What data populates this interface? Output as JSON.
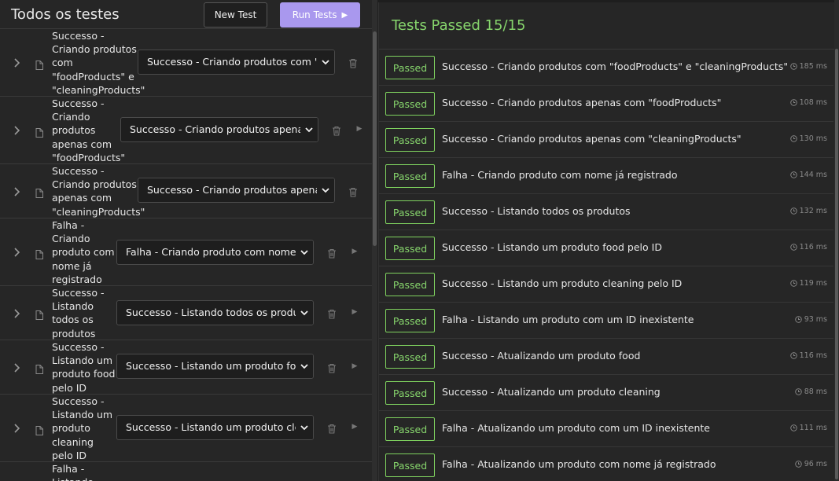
{
  "left": {
    "title": "Todos os testes",
    "new_test_label": "New Test",
    "run_tests_label": "Run Tests",
    "rows": [
      {
        "name": "Successo - Criando produtos com \"foodProducts\" e \"cleaningProducts\"",
        "select_value": "Successo - Criando produtos com \"foodProducts\" e \"cleaningProducts\""
      },
      {
        "name": "Successo - Criando produtos apenas com \"foodProducts\"",
        "select_value": "Successo - Criando produtos apenas com \"foodProducts\""
      },
      {
        "name": "Successo - Criando produtos apenas com \"cleaningProducts\"",
        "select_value": "Successo - Criando produtos apenas com \"cleaningProducts\""
      },
      {
        "name": "Falha - Criando produto com nome já registrado",
        "select_value": "Falha - Criando produto com nome já registrado"
      },
      {
        "name": "Successo - Listando todos os produtos",
        "select_value": "Successo - Listando todos os produtos"
      },
      {
        "name": "Successo - Listando um produto food pelo ID",
        "select_value": "Successo - Listando um produto food pelo ID"
      },
      {
        "name": "Successo - Listando um produto cleaning pelo ID",
        "select_value": "Successo - Listando um produto cleaning pelo ID"
      },
      {
        "name": "Falha - Listando",
        "select_value": ""
      }
    ]
  },
  "right": {
    "title": "Tests Passed 15/15",
    "results": [
      {
        "status": "Passed",
        "name": "Successo - Criando produtos com \"foodProducts\" e \"cleaningProducts\"",
        "time": "185 ms"
      },
      {
        "status": "Passed",
        "name": "Successo - Criando produtos apenas com \"foodProducts\"",
        "time": "108 ms"
      },
      {
        "status": "Passed",
        "name": "Successo - Criando produtos apenas com \"cleaningProducts\"",
        "time": "130 ms"
      },
      {
        "status": "Passed",
        "name": "Falha - Criando produto com nome já registrado",
        "time": "144 ms"
      },
      {
        "status": "Passed",
        "name": "Successo - Listando todos os produtos",
        "time": "132 ms"
      },
      {
        "status": "Passed",
        "name": "Successo - Listando um produto food pelo ID",
        "time": "116 ms"
      },
      {
        "status": "Passed",
        "name": "Successo - Listando um produto cleaning pelo ID",
        "time": "119 ms"
      },
      {
        "status": "Passed",
        "name": "Falha - Listando um produto com um ID inexistente",
        "time": "93 ms"
      },
      {
        "status": "Passed",
        "name": "Successo - Atualizando um produto food",
        "time": "116 ms"
      },
      {
        "status": "Passed",
        "name": "Successo - Atualizando um produto cleaning",
        "time": "88 ms"
      },
      {
        "status": "Passed",
        "name": "Falha - Atualizando um produto com um ID inexistente",
        "time": "111 ms"
      },
      {
        "status": "Passed",
        "name": "Falha - Atualizando um produto com nome já registrado",
        "time": "96 ms"
      }
    ]
  },
  "colors": {
    "accent_purple": "#a998ee",
    "passed_green": "#86d46c",
    "background": "#1e1e1e",
    "panel": "#262626"
  }
}
